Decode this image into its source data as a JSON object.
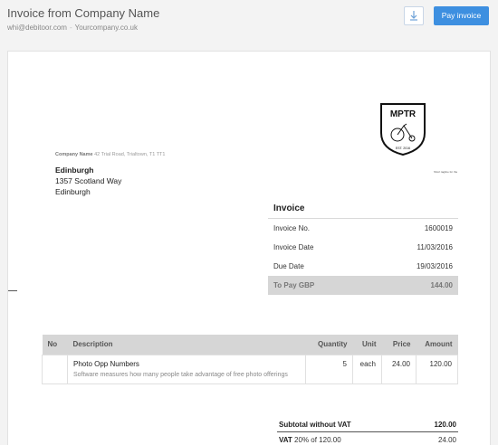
{
  "header": {
    "title": "Invoice from Company Name",
    "email": "whi@debitoor.com",
    "separator": "-",
    "website": "Yourcompany.co.uk",
    "download_icon": "download-icon",
    "pay_label": "Pay invoice"
  },
  "logo": {
    "text": "MPTR",
    "est": "EST. 2016",
    "caption": "Short tagline for the"
  },
  "sender": {
    "name": "Company Name",
    "address": "42 Trial Road, Trialtown, T1 TT1"
  },
  "recipient": {
    "name": "Edinburgh",
    "street": "1357 Scotland Way",
    "city": "Edinburgh"
  },
  "invoice": {
    "heading": "Invoice",
    "rows": [
      {
        "label": "Invoice No.",
        "value": "1600019"
      },
      {
        "label": "Invoice Date",
        "value": "11/03/2016"
      },
      {
        "label": "Due Date",
        "value": "19/03/2016"
      }
    ],
    "total_label": "To Pay GBP",
    "total_value": "144.00"
  },
  "items": {
    "columns": [
      "No",
      "Description",
      "Quantity",
      "Unit",
      "Price",
      "Amount"
    ],
    "rows": [
      {
        "no": "",
        "title": "Photo Opp Numbers",
        "desc": "Software measures how many people take advantage of free photo offerings",
        "quantity": "5",
        "unit": "each",
        "price": "24.00",
        "amount": "120.00"
      }
    ]
  },
  "totals": {
    "subtotal_label": "Subtotal without VAT",
    "subtotal_value": "120.00",
    "vat_label": "VAT",
    "vat_detail": "20% of 120.00",
    "vat_value": "24.00"
  }
}
